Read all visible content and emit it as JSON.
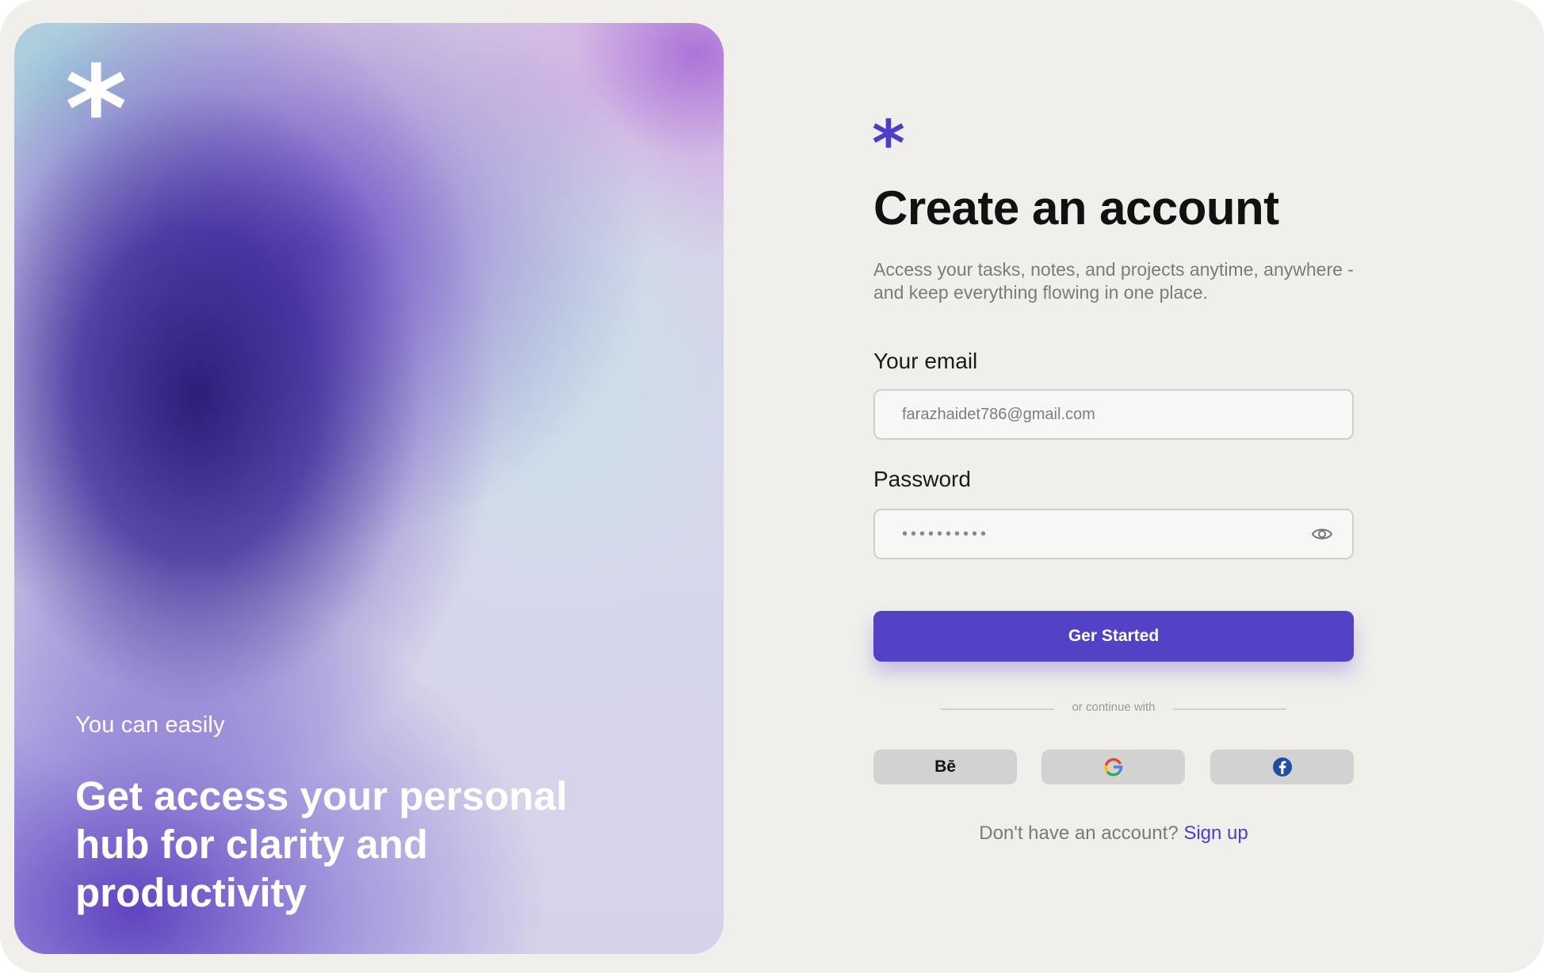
{
  "hero": {
    "logo_glyph": "*",
    "kicker": "You can easily",
    "headline": "Get access your personal hub for clarity and productivity"
  },
  "form": {
    "brand_glyph": "*",
    "title": "Create an account",
    "subtitle": "Access your tasks, notes, and projects anytime, anywhere - and keep everything flowing in one place.",
    "email": {
      "label": "Your email",
      "value": "farazhaidet786@gmail.com"
    },
    "password": {
      "label": "Password",
      "value": "••••••••••",
      "toggle_icon": "eye-icon"
    },
    "submit_label": "Ger Started",
    "divider_text": "or continue with",
    "social": [
      {
        "name": "behance",
        "glyph": "Bē"
      },
      {
        "name": "google",
        "icon": "google-icon"
      },
      {
        "name": "facebook",
        "icon": "facebook-icon"
      }
    ],
    "signup_prompt": "Don't have an account?",
    "signup_link": "Sign up"
  },
  "colors": {
    "accent": "#5342c6",
    "page_background": "#f0efec",
    "heading": "#111111",
    "muted_text": "#7b7b7b",
    "social_button": "#d2d2d2"
  }
}
